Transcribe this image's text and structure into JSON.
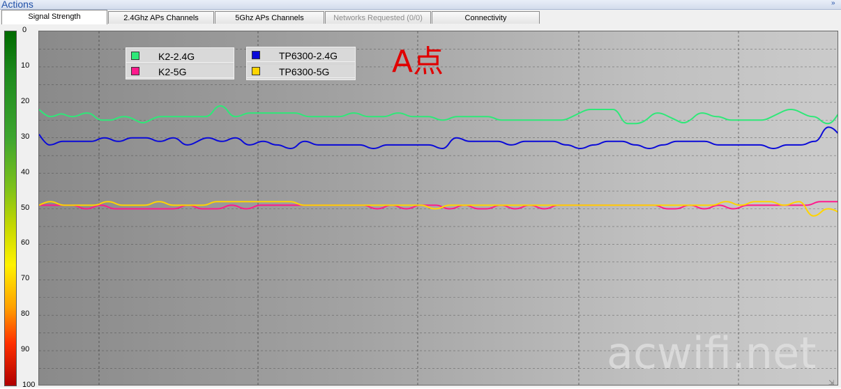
{
  "actions": {
    "title": "Actions",
    "collapse_icon": "chevron-double-down-icon"
  },
  "tabs": [
    {
      "label": "Signal Strength",
      "active": true
    },
    {
      "label": "2.4Ghz APs Channels"
    },
    {
      "label": "5Ghz APs Channels"
    },
    {
      "label": "Networks Requested (0/0)",
      "disabled": true
    },
    {
      "label": "Connectivity"
    }
  ],
  "annotation": "A点",
  "watermark": "acwifi.net",
  "chart_data": {
    "type": "line",
    "y_axis": {
      "ticks": [
        "0",
        "10",
        "20",
        "30",
        "40",
        "50",
        "60",
        "70",
        "80",
        "90",
        "100"
      ],
      "ylim": [
        0,
        100
      ],
      "inverted": true
    },
    "grid": true,
    "legend_placement": "top-left",
    "series": [
      {
        "name": "K2-2.4G",
        "color": "#2ee878",
        "values": [
          22,
          24,
          24,
          23,
          24,
          24,
          23,
          23,
          25,
          25,
          25,
          24,
          24,
          25,
          26,
          25,
          24,
          24,
          24,
          24,
          24,
          24,
          24,
          24,
          21,
          21,
          24,
          24,
          23,
          23,
          23,
          23,
          23,
          23,
          23,
          23,
          24,
          24,
          24,
          24,
          24,
          24,
          23,
          23,
          24,
          24,
          24,
          24,
          23,
          23,
          24,
          24,
          24,
          24,
          25,
          25,
          24,
          24,
          24,
          24,
          24,
          24,
          25,
          25,
          25,
          25,
          25,
          25,
          25,
          25,
          25,
          25,
          24,
          23,
          22,
          22,
          22,
          22,
          22,
          26,
          26,
          26,
          25,
          23,
          23,
          24,
          25,
          26,
          25,
          23,
          23,
          24,
          24,
          25,
          25,
          25,
          25,
          25,
          25,
          24,
          23,
          22,
          22,
          23,
          24,
          24,
          26,
          26,
          23
        ]
      },
      {
        "name": "K2-5G",
        "color": "#ff1a8c",
        "values": [
          49,
          49,
          49,
          49,
          49,
          49,
          50,
          50,
          49,
          49,
          50,
          50,
          50,
          50,
          50,
          50,
          50,
          50,
          50,
          50,
          49,
          49,
          50,
          50,
          50,
          50,
          49,
          49,
          50,
          50,
          49,
          49,
          49,
          49,
          49,
          49,
          49,
          49,
          49,
          49,
          49,
          49,
          49,
          49,
          49,
          49,
          50,
          50,
          49,
          49,
          50,
          50,
          49,
          49,
          49,
          49,
          50,
          50,
          49,
          49,
          50,
          50,
          50,
          49,
          49,
          50,
          50,
          49,
          49,
          50,
          50,
          49,
          49,
          49,
          49,
          49,
          49,
          49,
          49,
          49,
          49,
          49,
          49,
          49,
          49,
          49,
          50,
          50,
          50,
          49,
          49,
          50,
          50,
          49,
          49,
          50,
          50,
          49,
          49,
          49,
          49,
          49,
          49,
          49,
          49,
          49,
          49,
          48,
          48,
          48,
          48
        ]
      },
      {
        "name": "TP6300-2.4G",
        "color": "#0a0ad8",
        "values": [
          29,
          32,
          32,
          31,
          31,
          31,
          31,
          31,
          31,
          30,
          30,
          31,
          31,
          30,
          30,
          30,
          30,
          31,
          31,
          30,
          30,
          32,
          32,
          31,
          30,
          30,
          31,
          31,
          30,
          30,
          32,
          32,
          31,
          31,
          32,
          32,
          33,
          33,
          31,
          31,
          32,
          32,
          32,
          32,
          32,
          32,
          32,
          32,
          33,
          33,
          32,
          32,
          32,
          32,
          32,
          32,
          32,
          32,
          33,
          33,
          30,
          30,
          31,
          31,
          31,
          31,
          31,
          31,
          32,
          32,
          31,
          31,
          31,
          31,
          31,
          31,
          32,
          32,
          33,
          33,
          32,
          32,
          31,
          31,
          31,
          31,
          32,
          32,
          33,
          33,
          32,
          32,
          31,
          31,
          31,
          31,
          31,
          31,
          32,
          32,
          32,
          32,
          32,
          32,
          32,
          32,
          33,
          33,
          32,
          32,
          32,
          32,
          31,
          31,
          27,
          27,
          29
        ]
      },
      {
        "name": "TP6300-5G",
        "color": "#ffd400",
        "values": [
          49,
          48,
          48,
          49,
          49,
          49,
          49,
          49,
          49,
          48,
          48,
          49,
          49,
          49,
          49,
          49,
          48,
          48,
          49,
          49,
          49,
          49,
          49,
          49,
          48,
          48,
          48,
          48,
          48,
          48,
          48,
          48,
          48,
          48,
          48,
          48,
          49,
          49,
          49,
          49,
          49,
          49,
          49,
          49,
          49,
          49,
          49,
          49,
          49,
          49,
          49,
          49,
          49,
          49,
          50,
          50,
          49,
          49,
          49,
          49,
          49,
          49,
          49,
          49,
          49,
          49,
          49,
          49,
          49,
          49,
          49,
          49,
          49,
          49,
          49,
          49,
          49,
          49,
          49,
          49,
          49,
          49,
          49,
          49,
          49,
          49,
          49,
          49,
          49,
          49,
          49,
          49,
          49,
          49,
          48,
          48,
          49,
          49,
          48,
          48,
          48,
          48,
          49,
          49,
          48,
          48,
          52,
          52,
          50,
          50,
          51
        ]
      }
    ]
  }
}
